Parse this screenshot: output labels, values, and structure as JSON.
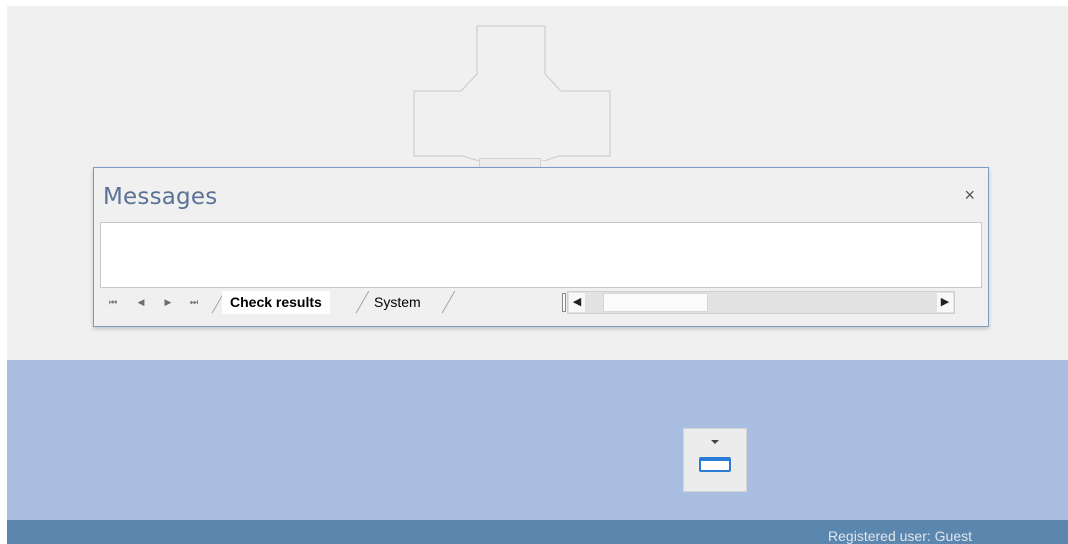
{
  "panel": {
    "title": "Messages",
    "close_glyph": "×",
    "tabs": [
      {
        "label": "Check results",
        "active": true
      },
      {
        "label": "System",
        "active": false
      }
    ],
    "nav": {
      "first_glyph": "⏮",
      "prev_glyph": "◀",
      "next_glyph": "▶",
      "last_glyph": "⏭"
    },
    "scroll": {
      "left_glyph": "◀",
      "right_glyph": "▶"
    }
  },
  "status_bar": {
    "text": "Registered user: Guest"
  },
  "icons": {
    "dock_top": "dock-top-icon",
    "dock_cross": "dock-guide-cross",
    "dock_area": "dock-top-icon"
  },
  "colors": {
    "workspace": "#f0f0f0",
    "dock_area": "#a9bde0",
    "status_bar": "#5b86ad",
    "panel_border": "#7a9cc4",
    "title_text": "#5a7395",
    "dock_icon_accent": "#2a7bd5"
  }
}
